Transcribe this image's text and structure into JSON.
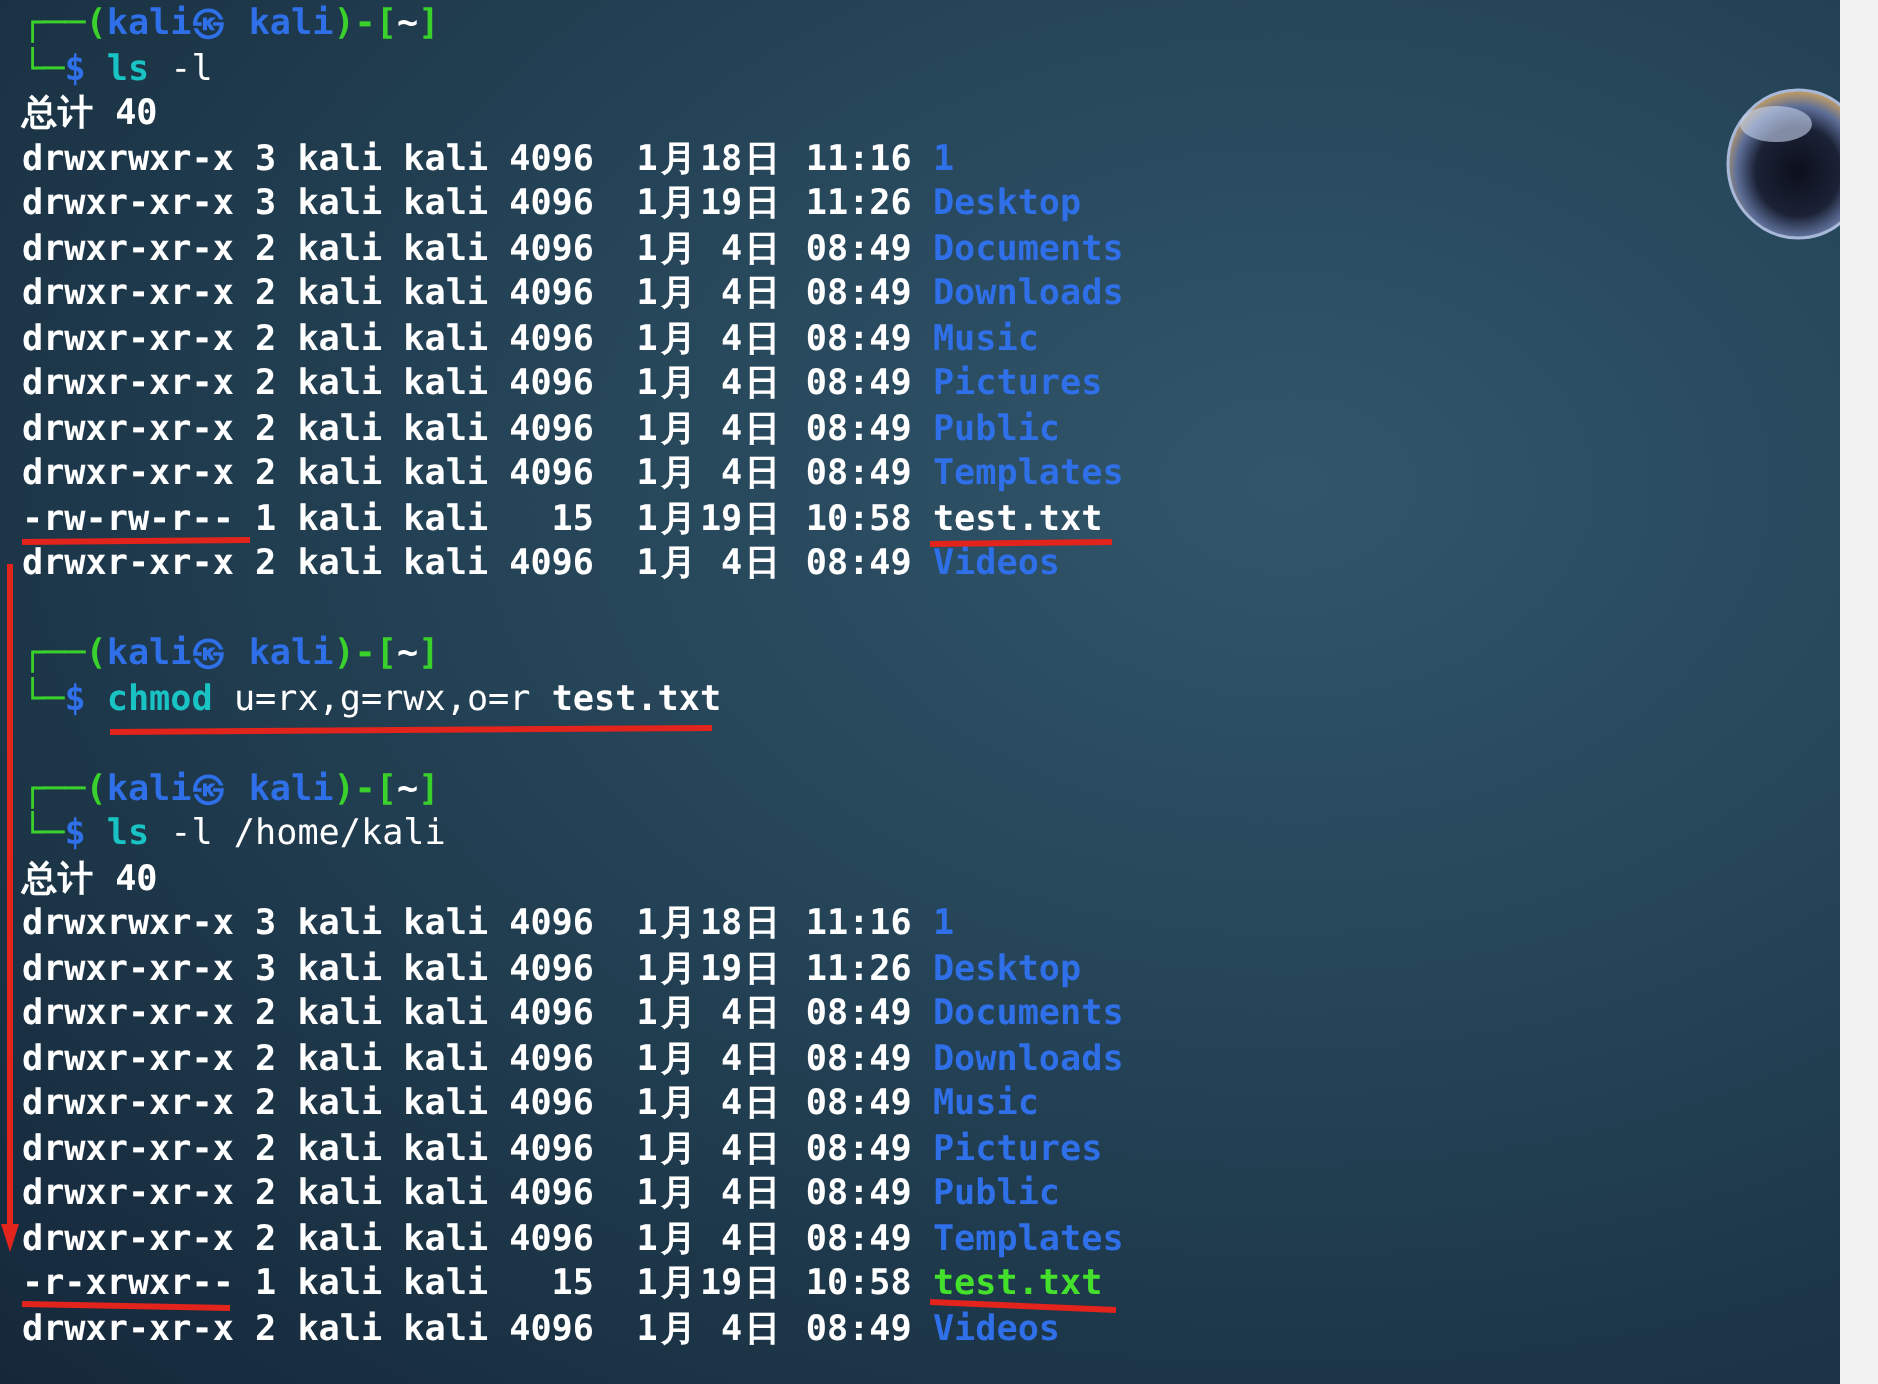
{
  "blocks": [
    {
      "prompt": {
        "open": "┌──(",
        "user": "kali㉿ kali",
        "mid": ")-[",
        "dir": "~",
        "close": "]",
        "corner": "└─",
        "symbol": "$"
      },
      "command": {
        "name": "ls",
        "args": "-l"
      },
      "output": {
        "total": "总计 40",
        "entries": [
          {
            "mode": "drwxrwxr-x",
            "links": "3",
            "owner": "kali",
            "group": "kali",
            "size": "4096",
            "date": "1月18日",
            "time": "11:16",
            "name": "1",
            "kind": "dir"
          },
          {
            "mode": "drwxr-xr-x",
            "links": "3",
            "owner": "kali",
            "group": "kali",
            "size": "4096",
            "date": "1月19日",
            "time": "11:26",
            "name": "Desktop",
            "kind": "dir"
          },
          {
            "mode": "drwxr-xr-x",
            "links": "2",
            "owner": "kali",
            "group": "kali",
            "size": "4096",
            "date": "1月 4日",
            "time": "08:49",
            "name": "Documents",
            "kind": "dir"
          },
          {
            "mode": "drwxr-xr-x",
            "links": "2",
            "owner": "kali",
            "group": "kali",
            "size": "4096",
            "date": "1月 4日",
            "time": "08:49",
            "name": "Downloads",
            "kind": "dir"
          },
          {
            "mode": "drwxr-xr-x",
            "links": "2",
            "owner": "kali",
            "group": "kali",
            "size": "4096",
            "date": "1月 4日",
            "time": "08:49",
            "name": "Music",
            "kind": "dir"
          },
          {
            "mode": "drwxr-xr-x",
            "links": "2",
            "owner": "kali",
            "group": "kali",
            "size": "4096",
            "date": "1月 4日",
            "time": "08:49",
            "name": "Pictures",
            "kind": "dir"
          },
          {
            "mode": "drwxr-xr-x",
            "links": "2",
            "owner": "kali",
            "group": "kali",
            "size": "4096",
            "date": "1月 4日",
            "time": "08:49",
            "name": "Public",
            "kind": "dir"
          },
          {
            "mode": "drwxr-xr-x",
            "links": "2",
            "owner": "kali",
            "group": "kali",
            "size": "4096",
            "date": "1月 4日",
            "time": "08:49",
            "name": "Templates",
            "kind": "dir"
          },
          {
            "mode": "-rw-rw-r--",
            "links": "1",
            "owner": "kali",
            "group": "kali",
            "size": "15",
            "date": "1月19日",
            "time": "10:58",
            "name": "test.txt",
            "kind": "file"
          },
          {
            "mode": "drwxr-xr-x",
            "links": "2",
            "owner": "kali",
            "group": "kali",
            "size": "4096",
            "date": "1月 4日",
            "time": "08:49",
            "name": "Videos",
            "kind": "dir"
          }
        ]
      }
    },
    {
      "prompt": {
        "open": "┌──(",
        "user": "kali㉿ kali",
        "mid": ")-[",
        "dir": "~",
        "close": "]",
        "corner": "└─",
        "symbol": "$"
      },
      "command": {
        "name": "chmod",
        "args": "u=rx,g=rwx,o=r **test.txt**"
      }
    },
    {
      "prompt": {
        "open": "┌──(",
        "user": "kali㉿ kali",
        "mid": ")-[",
        "dir": "~",
        "close": "]",
        "corner": "└─",
        "symbol": "$"
      },
      "command": {
        "name": "ls",
        "args": "-l /home/kali"
      },
      "output": {
        "total": "总计 40",
        "entries": [
          {
            "mode": "drwxrwxr-x",
            "links": "3",
            "owner": "kali",
            "group": "kali",
            "size": "4096",
            "date": "1月18日",
            "time": "11:16",
            "name": "1",
            "kind": "dir"
          },
          {
            "mode": "drwxr-xr-x",
            "links": "3",
            "owner": "kali",
            "group": "kali",
            "size": "4096",
            "date": "1月19日",
            "time": "11:26",
            "name": "Desktop",
            "kind": "dir"
          },
          {
            "mode": "drwxr-xr-x",
            "links": "2",
            "owner": "kali",
            "group": "kali",
            "size": "4096",
            "date": "1月 4日",
            "time": "08:49",
            "name": "Documents",
            "kind": "dir"
          },
          {
            "mode": "drwxr-xr-x",
            "links": "2",
            "owner": "kali",
            "group": "kali",
            "size": "4096",
            "date": "1月 4日",
            "time": "08:49",
            "name": "Downloads",
            "kind": "dir"
          },
          {
            "mode": "drwxr-xr-x",
            "links": "2",
            "owner": "kali",
            "group": "kali",
            "size": "4096",
            "date": "1月 4日",
            "time": "08:49",
            "name": "Music",
            "kind": "dir"
          },
          {
            "mode": "drwxr-xr-x",
            "links": "2",
            "owner": "kali",
            "group": "kali",
            "size": "4096",
            "date": "1月 4日",
            "time": "08:49",
            "name": "Pictures",
            "kind": "dir"
          },
          {
            "mode": "drwxr-xr-x",
            "links": "2",
            "owner": "kali",
            "group": "kali",
            "size": "4096",
            "date": "1月 4日",
            "time": "08:49",
            "name": "Public",
            "kind": "dir"
          },
          {
            "mode": "drwxr-xr-x",
            "links": "2",
            "owner": "kali",
            "group": "kali",
            "size": "4096",
            "date": "1月 4日",
            "time": "08:49",
            "name": "Templates",
            "kind": "dir"
          },
          {
            "mode": "-r-xrwxr--",
            "links": "1",
            "owner": "kali",
            "group": "kali",
            "size": "15",
            "date": "1月19日",
            "time": "10:58",
            "name": "test.txt",
            "kind": "exec"
          },
          {
            "mode": "drwxr-xr-x",
            "links": "2",
            "owner": "kali",
            "group": "kali",
            "size": "4096",
            "date": "1月 4日",
            "time": "08:49",
            "name": "Videos",
            "kind": "dir"
          }
        ]
      }
    }
  ]
}
